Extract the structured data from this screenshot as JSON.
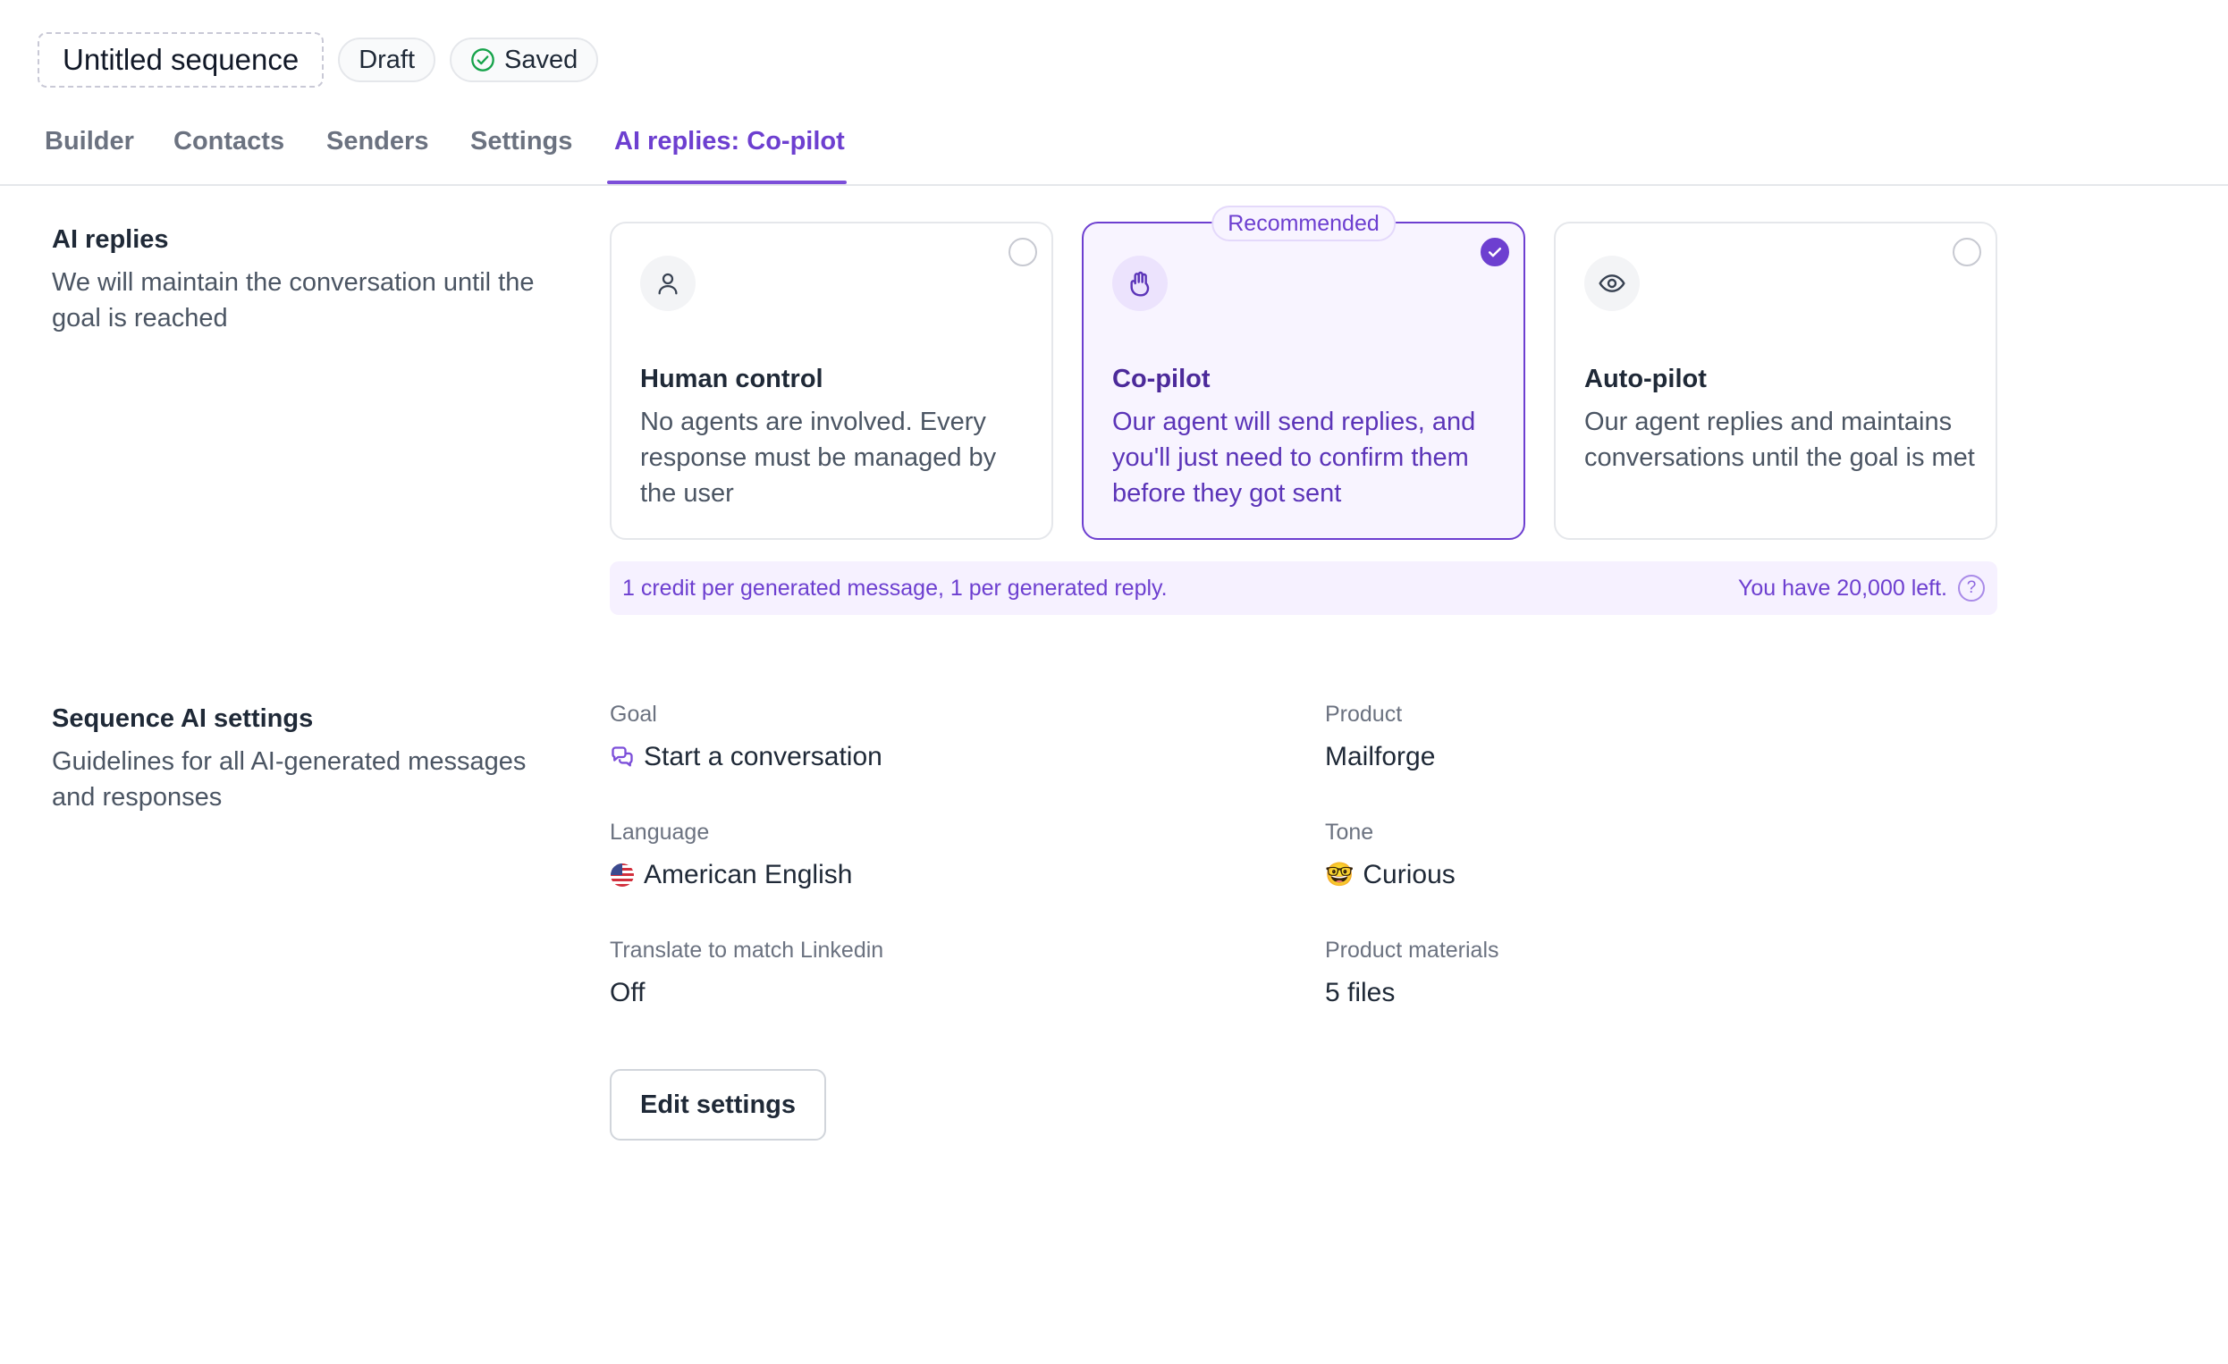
{
  "header": {
    "title": "Untitled sequence",
    "status": "Draft",
    "saved": "Saved"
  },
  "tabs": [
    {
      "label": "Builder",
      "active": false
    },
    {
      "label": "Contacts",
      "active": false
    },
    {
      "label": "Senders",
      "active": false
    },
    {
      "label": "Settings",
      "active": false
    },
    {
      "label": "AI replies: Co-pilot",
      "active": true
    }
  ],
  "ai_replies": {
    "title": "AI replies",
    "description": "We will maintain the conversation until the goal is reached",
    "options": [
      {
        "title": "Human control",
        "description": "No agents are involved. Every response must be managed by the user",
        "icon": "person-icon",
        "selected": false
      },
      {
        "title": "Co-pilot",
        "description": "Our agent will send replies, and you'll just need to confirm them before they got sent",
        "icon": "hand-icon",
        "selected": true,
        "badge": "Recommended"
      },
      {
        "title": "Auto-pilot",
        "description": "Our agent replies and maintains conversations until the goal is met",
        "icon": "eye-icon",
        "selected": false
      }
    ],
    "credit_note": "1 credit per generated message, 1 per generated reply.",
    "credits_left": "You have 20,000 left.",
    "help_icon": "?"
  },
  "sequence_settings": {
    "title": "Sequence AI settings",
    "description": "Guidelines for all AI-generated messages and responses",
    "fields": {
      "goal": {
        "label": "Goal",
        "value": "Start a conversation",
        "icon": "chat-bubbles-icon"
      },
      "product": {
        "label": "Product",
        "value": "Mailforge"
      },
      "language": {
        "label": "Language",
        "value": "American English",
        "icon": "us-flag-icon"
      },
      "tone": {
        "label": "Tone",
        "value": "Curious",
        "emoji": "🤓"
      },
      "translate": {
        "label": "Translate to match Linkedin",
        "value": "Off"
      },
      "materials": {
        "label": "Product materials",
        "value": "5 files"
      }
    },
    "edit_button": "Edit settings"
  },
  "colors": {
    "accent": "#6d3fd0",
    "accent_bg": "#f8f4ff",
    "success": "#16a34a"
  }
}
